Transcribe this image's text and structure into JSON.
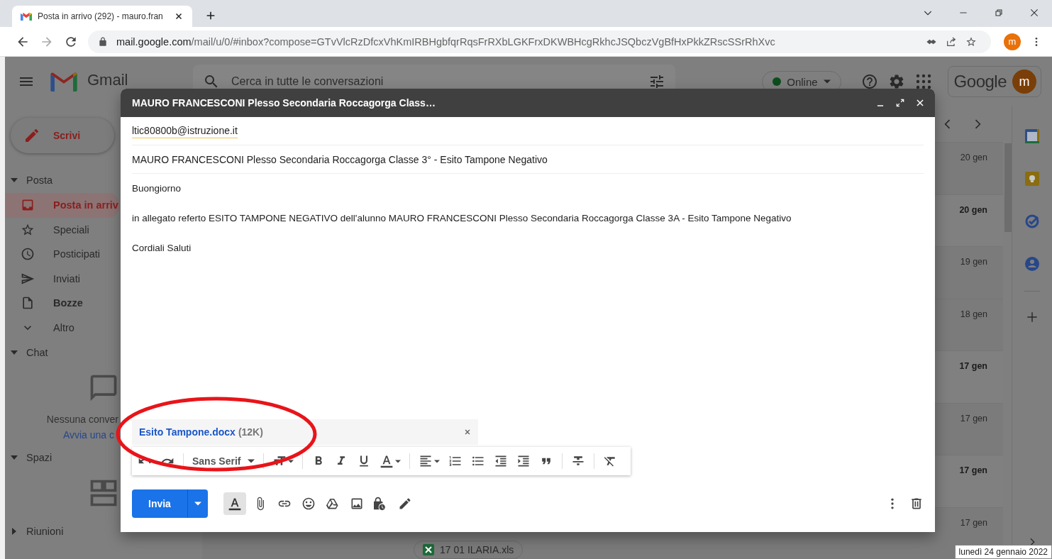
{
  "browser": {
    "tab": {
      "title": "Posta in arrivo (292) - mauro.fran"
    },
    "url": {
      "host": "mail.google.com",
      "rest": "/mail/u/0/#inbox?compose=GTvVlcRzDfcxVhKmIRBHgbfqrRqsFrRXbLGKFrxDKWBHcgRkhcJSQbczVgBfHxPkkZRscSSrRhXvc"
    },
    "avatar": "m"
  },
  "gmail": {
    "logo_text": "Gmail",
    "search": {
      "placeholder": "Cerca in tutte le conversazioni"
    },
    "status": "Online",
    "account_brand": "Google",
    "avatar": "m"
  },
  "sidebar": {
    "compose_label": "Scrivi",
    "sections": [
      {
        "title": "Posta",
        "expanded": true,
        "items": [
          {
            "label": "Posta in arriv",
            "selected": true,
            "bold": true
          },
          {
            "label": "Speciali",
            "selected": false,
            "bold": false
          },
          {
            "label": "Posticipati",
            "selected": false,
            "bold": false
          },
          {
            "label": "Inviati",
            "selected": false,
            "bold": false
          },
          {
            "label": "Bozze",
            "selected": false,
            "bold": true
          },
          {
            "label": "Altro",
            "selected": false,
            "bold": false
          }
        ]
      },
      {
        "title": "Chat",
        "expanded": true,
        "empty_text": "Nessuna conver",
        "empty_link": "Avvia una c"
      },
      {
        "title": "Spazi",
        "expanded": true
      },
      {
        "title": "Riunioni",
        "expanded": false
      }
    ]
  },
  "emails": [
    {
      "date": "20 gen",
      "unread": false
    },
    {
      "date": "20 gen",
      "unread": true
    },
    {
      "date": "19 gen",
      "unread": false
    },
    {
      "date": "18 gen",
      "unread": false
    },
    {
      "date": "17 gen",
      "unread": true
    },
    {
      "date": "17 gen",
      "unread": false
    },
    {
      "date": "17 gen",
      "unread": true
    },
    {
      "date": "17 gen",
      "unread": false,
      "attachment": "17 01 ILARIA.xls"
    }
  ],
  "compose": {
    "title": "MAURO FRANCESCONI Plesso Secondaria Roccagorga Class…",
    "to": "ltic80800b@istruzione.it",
    "subject": "MAURO FRANCESCONI Plesso Secondaria Roccagorga Classe 3° - Esito Tampone Negativo",
    "body": [
      "Buongiorno",
      "in allegato referto ESITO TAMPONE NEGATIVO dell'alunno MAURO FRANCESCONI Plesso Secondaria Roccagorga Classe 3A - Esito Tampone Negativo",
      "Cordiali Saluti"
    ],
    "attachment": {
      "name": "Esito Tampone.docx",
      "size": "(12K)"
    },
    "font": "Sans Serif",
    "send_label": "Invia"
  },
  "tooltip": "lunedì 24 gennaio 2022"
}
